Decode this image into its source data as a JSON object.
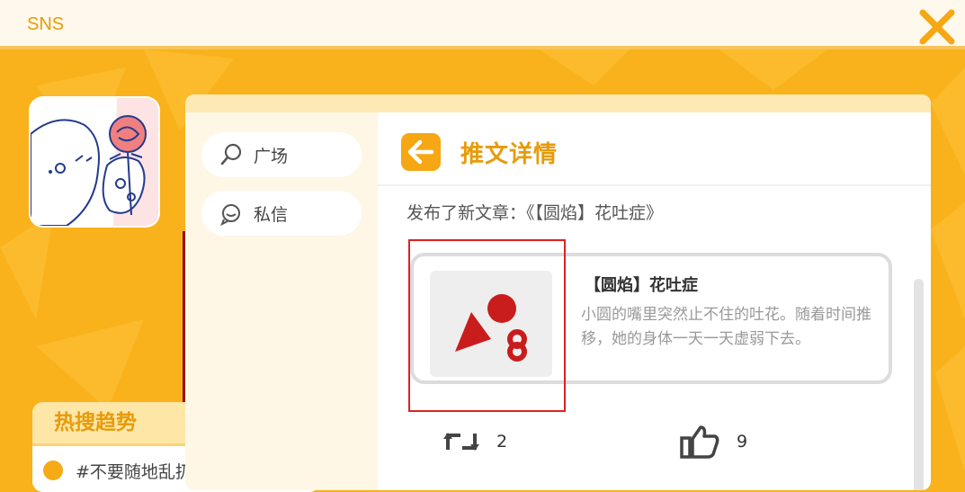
{
  "window": {
    "title": "SNS"
  },
  "nav": {
    "items": [
      {
        "label": "广场",
        "icon": "search-icon"
      },
      {
        "label": "私信",
        "icon": "chat-bubble-icon"
      }
    ]
  },
  "trends": {
    "title": "热搜趋势",
    "items": [
      {
        "label": "#不要随地乱扔抹布"
      }
    ]
  },
  "detail": {
    "title": "推文详情",
    "intro": "发布了新文章：《【圆焰】花吐症》",
    "article": {
      "title": "【圆焰】花吐症",
      "summary": "小圆的嘴里突然止不住的吐花。随着时间推移，她的身体一天一天虚弱下去。"
    },
    "repost_count": "2",
    "like_count": "9"
  },
  "colors": {
    "background": "#f9b21c",
    "accent": "#e79b09",
    "ao3_red": "#990000",
    "highlight": "#e02020"
  }
}
